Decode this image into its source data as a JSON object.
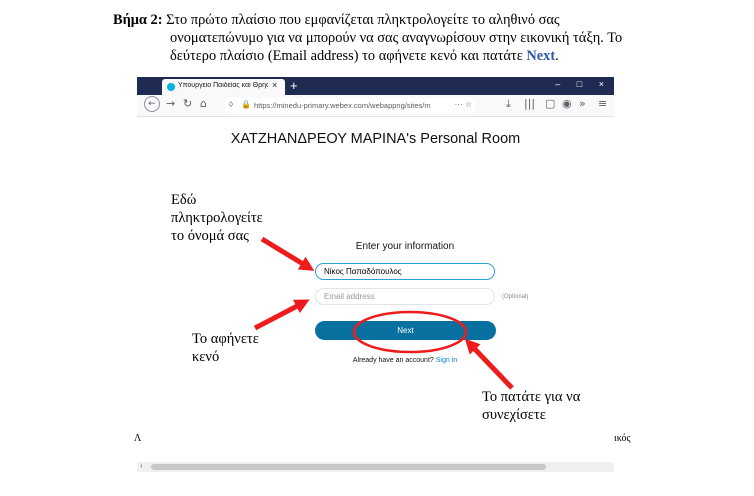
{
  "instructions": {
    "step_label": "Βήμα 2:",
    "line1": "Στο πρώτο πλαίσιο που εμφανίζεται πληκτρολογείτε το αληθινό σας",
    "line2": "ονοματεπώνυμο για να μπορούν να σας αναγνωρίσουν στην εικονική τάξη.  Το",
    "line3_pre": "δεύτερο πλαίσιο (Email address) το αφήνετε κενό και πατάτε ",
    "line3_link": "Next",
    "line3_post": "."
  },
  "browser": {
    "tab_title": "Υπουργείο Παιδείας και Θρησκευμάτων",
    "tab_close": "×",
    "new_tab": "+",
    "url": "https://minedu-primary.webex.com/webappng/sites/m",
    "url_extras": "··· ☆",
    "win_min": "–",
    "win_max": "□",
    "win_close": "×",
    "icons": [
      "back-icon",
      "forward-icon",
      "reload-icon",
      "home-icon",
      "shield-icon",
      "lock-icon",
      "download-icon",
      "library-icon",
      "sidebar-icon",
      "account-icon",
      "overflow-icon",
      "menu-icon"
    ]
  },
  "webex": {
    "room_title": "ΧΑΤΖΗΑΝΔΡΕΟΥ ΜΑΡΙΝΑ's Personal Room",
    "enter_info": "Enter your information",
    "name_value": "Νίκος Παπαδόπουλος",
    "email_placeholder": "Email address",
    "optional_label": "(Optional)",
    "next_label": "Next",
    "account_text": "Already have an account?",
    "signin_label": "Sign in"
  },
  "annotations": {
    "a1_line1": "Εδώ",
    "a1_line2": "πληκτρολογείτε",
    "a1_line3": "το όνομά σας",
    "a2_line1": "Το αφήνετε",
    "a2_line2": "κενό",
    "a3_line1": "Το πατάτε για να",
    "a3_line2": "συνεχίσετε"
  },
  "fragments": {
    "left": "Λ",
    "right": "ικός"
  },
  "colors": {
    "arrow": "#ee1c1c",
    "next_button": "#08709f",
    "tabbar": "#1f2b53",
    "link": "#2e5aa7"
  }
}
